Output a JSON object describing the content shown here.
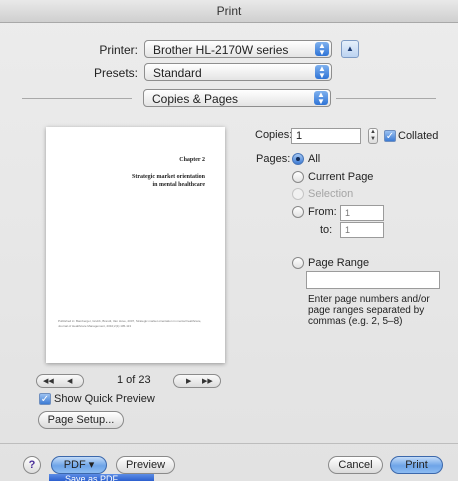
{
  "window": {
    "title": "Print"
  },
  "printer": {
    "label": "Printer:",
    "value": "Brother HL-2170W series"
  },
  "presets": {
    "label": "Presets:",
    "value": "Standard"
  },
  "panel": {
    "value": "Copies & Pages"
  },
  "preview": {
    "chapter": "Chapter 2",
    "title_line1": "Strategic market orientation",
    "title_line2": "in mental healthcare",
    "footnote": "Published in: Bamberger, Grubb, Brandt, Van Hove, 2007, Strategic market orientation in mental healthcare, Journal of Healthcare Management, 2010;2(1):105-113"
  },
  "navigation": {
    "page_text": "1 of 23",
    "first": "◀◀",
    "prev": "◀",
    "next": "▶",
    "last": "▶▶"
  },
  "show_quick_preview": {
    "label": "Show Quick Preview",
    "checked": true
  },
  "page_setup": {
    "label": "Page Setup..."
  },
  "copies": {
    "label": "Copies:",
    "value": "1",
    "collated_label": "Collated",
    "collated_checked": true
  },
  "pages": {
    "label": "Pages:",
    "all": "All",
    "current_page": "Current Page",
    "selection": "Selection",
    "from_label": "From:",
    "from_value": "1",
    "to_label": "to:",
    "to_value": "1",
    "page_range": "Page Range",
    "range_value": "",
    "help_line1": "Enter page numbers and/or",
    "help_line2": "page ranges separated by",
    "help_line3": "commas (e.g. 2, 5–8)",
    "selected": "All"
  },
  "footer": {
    "help": "?",
    "pdf": "PDF ▾",
    "preview": "Preview",
    "cancel": "Cancel",
    "print": "Print",
    "pdf_menu_item": "Save as PDF..."
  },
  "icons": {
    "popup_arrows": "up-down-arrows-icon",
    "disclosure": "disclosure-triangle-icon"
  },
  "colors": {
    "accent": "#3c7ad4",
    "background": "#e6e6e6"
  }
}
